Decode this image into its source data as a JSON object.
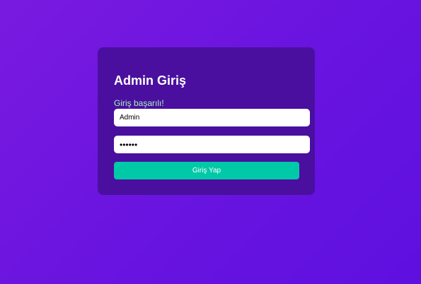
{
  "login": {
    "title": "Admin Giriş",
    "status_message": "Giriş başarılı!",
    "username_value": "Admin",
    "password_value": "123456",
    "submit_label": "Giriş Yap"
  },
  "colors": {
    "background_start": "#7a1ae0",
    "background_end": "#5e10e0",
    "card": "#4a0f9f",
    "status_text": "#a7f3c0",
    "button": "#00c9a7"
  }
}
